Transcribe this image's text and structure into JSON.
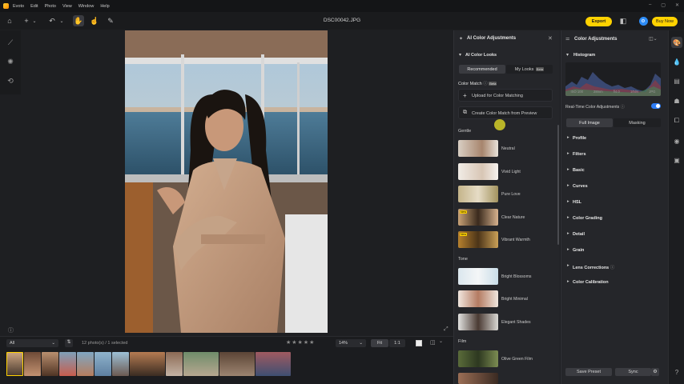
{
  "menu": {
    "app": "Evoto",
    "items": [
      "Edit",
      "Photo",
      "View",
      "Window",
      "Help"
    ]
  },
  "window": {
    "title": "DSC00042.JPG",
    "minimize": "–",
    "maximize": "▢",
    "close": "✕"
  },
  "toolbar": {
    "export": "Export",
    "buy_now": "Buy Now"
  },
  "ai_panel": {
    "title": "AI Color Adjustments",
    "section": "AI Color Looks",
    "tabs": [
      "Recommended",
      "My Looks"
    ],
    "beta": "Beta",
    "color_match": "Color Match",
    "upload": "Upload for Color Matching",
    "create": "Create Color Match from Preview",
    "categories": {
      "gentle": "Gentle",
      "tone": "Tone",
      "film": "Film"
    },
    "looks_gentle": [
      "Neutral",
      "Vivid Light",
      "Pure Love",
      "Clear Nature",
      "Vibrant Warmth"
    ],
    "looks_tone": [
      "Bright Blossoms",
      "Bright Minimal",
      "Elegant Shades"
    ],
    "looks_film": [
      "Olive Green Film"
    ],
    "new_tag": "New"
  },
  "right_panel": {
    "title": "Color Adjustments",
    "histogram": "Histogram",
    "meta": [
      "ISO 100",
      "28mm",
      "f/4.0",
      "1/50s",
      "JPG"
    ],
    "realtime": "Real-Time Color Adjustments",
    "tabs": [
      "Full Image",
      "Masking"
    ],
    "sections": [
      "Profile",
      "Filters",
      "Basic",
      "Curves",
      "HSL",
      "Color Grading",
      "Detail",
      "Grain",
      "Lens Corrections",
      "Color Calibration"
    ],
    "save_preset": "Save Preset",
    "sync": "Sync"
  },
  "filmstrip": {
    "filter": "All",
    "count": "12 photo(s) / 1 selected",
    "stars": "★★★★★",
    "zoom": "14%",
    "fit": "Fit",
    "one_to_one": "1:1"
  },
  "colors": {
    "accent": "#ffd200",
    "toggle": "#2d7cf6",
    "panel": "#25262a"
  }
}
